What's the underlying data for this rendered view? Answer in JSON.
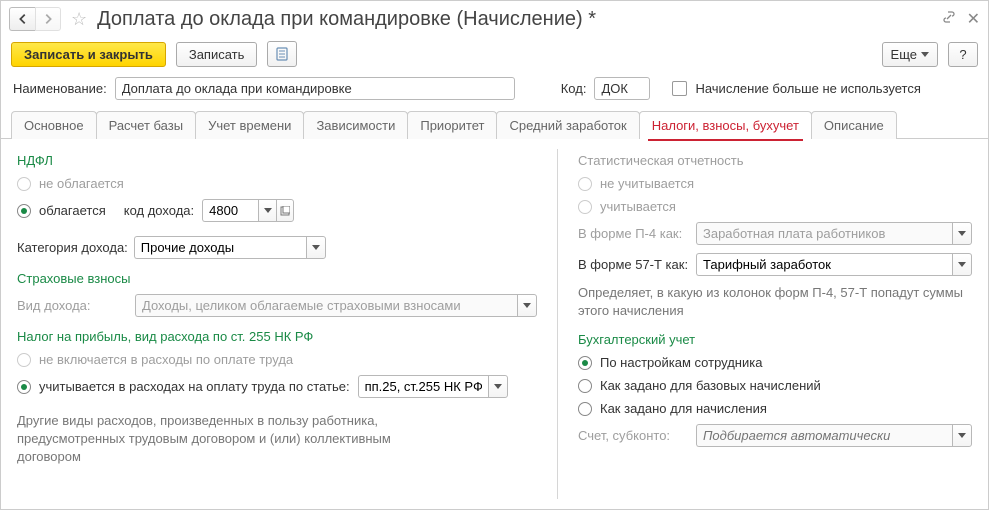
{
  "titlebar": {
    "title": "Доплата до оклада при командировке (Начисление) *"
  },
  "toolbar": {
    "save_close": "Записать и закрыть",
    "save": "Записать",
    "more": "Еще",
    "help": "?"
  },
  "header": {
    "name_label": "Наименование:",
    "name_value": "Доплата до оклада при командировке",
    "code_label": "Код:",
    "code_value": "ДОК",
    "not_used": "Начисление больше не используется"
  },
  "tabs": [
    "Основное",
    "Расчет базы",
    "Учет времени",
    "Зависимости",
    "Приоритет",
    "Средний заработок",
    "Налоги, взносы, бухучет",
    "Описание"
  ],
  "left": {
    "ndfl_title": "НДФЛ",
    "ndfl_not_taxed": "не облагается",
    "ndfl_taxed": "облагается",
    "income_code_label": "код дохода:",
    "income_code": "4800",
    "income_cat_label": "Категория дохода:",
    "income_cat": "Прочие доходы",
    "insurance_title": "Страховые взносы",
    "income_type_label": "Вид дохода:",
    "income_type": "Доходы, целиком облагаемые страховыми взносами",
    "profit_tax_title": "Налог на прибыль, вид расхода по ст. 255 НК РФ",
    "not_included": "не включается в расходы по оплате труда",
    "included": "учитывается в расходах на оплату труда по статье:",
    "article": "пп.25, ст.255 НК РФ",
    "other_expenses": "Другие виды расходов, произведенных в пользу работника, предусмотренных трудовым договором и (или) коллективным договором"
  },
  "right": {
    "stat_title": "Статистическая отчетность",
    "stat_not_counted": "не учитывается",
    "stat_counted": "учитывается",
    "form_p4_label": "В форме П-4 как:",
    "form_p4_value": "Заработная плата работников",
    "form_57t_label": "В форме 57-Т как:",
    "form_57t_value": "Тарифный заработок",
    "hint": "Определяет, в какую из колонок форм П-4, 57-Т попадут суммы этого начисления",
    "accounting_title": "Бухгалтерский учет",
    "acc_by_employee": "По настройкам сотрудника",
    "acc_by_base": "Как задано для базовых начислений",
    "acc_for_charge": "Как задано для начисления",
    "account_label": "Счет, субконто:",
    "account_placeholder": "Подбирается автоматически"
  }
}
